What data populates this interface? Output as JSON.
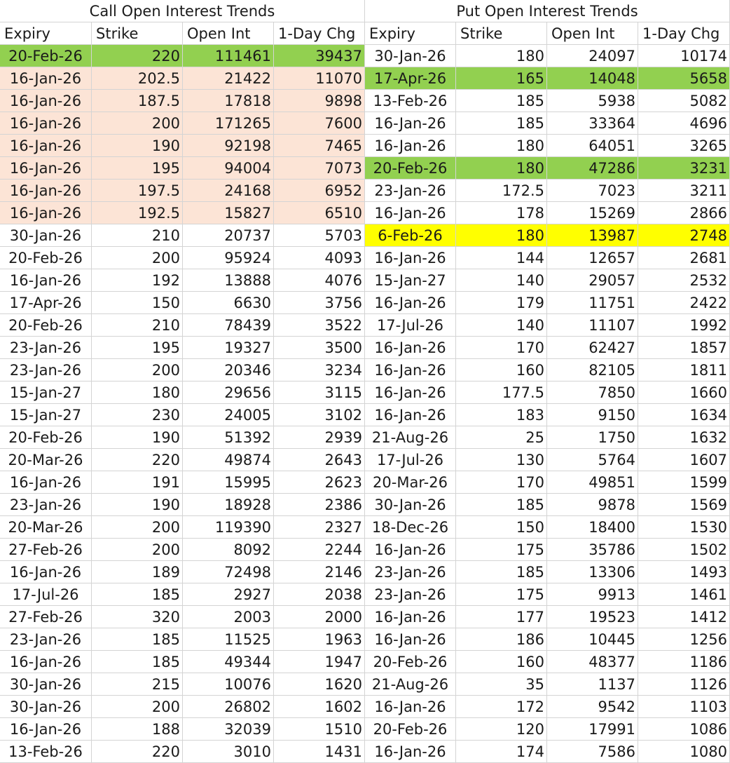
{
  "colors": {
    "pink": "#fce4d6",
    "green": "#92d050",
    "yellow": "#ffff00",
    "gridline": "#d4d4d4"
  },
  "call": {
    "title": "Call Open Interest Trends",
    "headers": [
      "Expiry",
      "Strike",
      "Open Int",
      "1-Day Chg"
    ],
    "rows": [
      [
        "20-Feb-26",
        "220",
        "111461",
        "39437",
        "green"
      ],
      [
        "16-Jan-26",
        "202.5",
        "21422",
        "11070",
        "pink"
      ],
      [
        "16-Jan-26",
        "187.5",
        "17818",
        "9898",
        "pink"
      ],
      [
        "16-Jan-26",
        "200",
        "171265",
        "7600",
        "pink"
      ],
      [
        "16-Jan-26",
        "190",
        "92198",
        "7465",
        "pink"
      ],
      [
        "16-Jan-26",
        "195",
        "94004",
        "7073",
        "pink"
      ],
      [
        "16-Jan-26",
        "197.5",
        "24168",
        "6952",
        "pink"
      ],
      [
        "16-Jan-26",
        "192.5",
        "15827",
        "6510",
        "pink"
      ],
      [
        "30-Jan-26",
        "210",
        "20737",
        "5703",
        ""
      ],
      [
        "20-Feb-26",
        "200",
        "95924",
        "4093",
        ""
      ],
      [
        "16-Jan-26",
        "192",
        "13888",
        "4076",
        ""
      ],
      [
        "17-Apr-26",
        "150",
        "6630",
        "3756",
        ""
      ],
      [
        "20-Feb-26",
        "210",
        "78439",
        "3522",
        ""
      ],
      [
        "23-Jan-26",
        "195",
        "19327",
        "3500",
        ""
      ],
      [
        "23-Jan-26",
        "200",
        "20346",
        "3234",
        ""
      ],
      [
        "15-Jan-27",
        "180",
        "29656",
        "3115",
        ""
      ],
      [
        "15-Jan-27",
        "230",
        "24005",
        "3102",
        ""
      ],
      [
        "20-Feb-26",
        "190",
        "51392",
        "2939",
        ""
      ],
      [
        "20-Mar-26",
        "220",
        "49874",
        "2643",
        ""
      ],
      [
        "16-Jan-26",
        "191",
        "15995",
        "2623",
        ""
      ],
      [
        "23-Jan-26",
        "190",
        "18928",
        "2386",
        ""
      ],
      [
        "20-Mar-26",
        "200",
        "119390",
        "2327",
        ""
      ],
      [
        "27-Feb-26",
        "200",
        "8092",
        "2244",
        ""
      ],
      [
        "16-Jan-26",
        "189",
        "72498",
        "2146",
        ""
      ],
      [
        "17-Jul-26",
        "185",
        "2927",
        "2038",
        ""
      ],
      [
        "27-Feb-26",
        "320",
        "2003",
        "2000",
        ""
      ],
      [
        "23-Jan-26",
        "185",
        "11525",
        "1963",
        ""
      ],
      [
        "16-Jan-26",
        "185",
        "49344",
        "1947",
        ""
      ],
      [
        "30-Jan-26",
        "215",
        "10076",
        "1620",
        ""
      ],
      [
        "30-Jan-26",
        "200",
        "26802",
        "1602",
        ""
      ],
      [
        "16-Jan-26",
        "188",
        "32039",
        "1510",
        ""
      ],
      [
        "13-Feb-26",
        "220",
        "3010",
        "1431",
        ""
      ]
    ]
  },
  "put": {
    "title": "Put Open Interest Trends",
    "headers": [
      "Expiry",
      "Strike",
      "Open Int",
      "1-Day Chg"
    ],
    "rows": [
      [
        "30-Jan-26",
        "180",
        "24097",
        "10174",
        ""
      ],
      [
        "17-Apr-26",
        "165",
        "14048",
        "5658",
        "green"
      ],
      [
        "13-Feb-26",
        "185",
        "5938",
        "5082",
        ""
      ],
      [
        "16-Jan-26",
        "185",
        "33364",
        "4696",
        ""
      ],
      [
        "16-Jan-26",
        "180",
        "64051",
        "3265",
        ""
      ],
      [
        "20-Feb-26",
        "180",
        "47286",
        "3231",
        "green"
      ],
      [
        "23-Jan-26",
        "172.5",
        "7023",
        "3211",
        ""
      ],
      [
        "16-Jan-26",
        "178",
        "15269",
        "2866",
        ""
      ],
      [
        "6-Feb-26",
        "180",
        "13987",
        "2748",
        "yellow"
      ],
      [
        "16-Jan-26",
        "144",
        "12657",
        "2681",
        ""
      ],
      [
        "15-Jan-27",
        "140",
        "29057",
        "2532",
        ""
      ],
      [
        "16-Jan-26",
        "179",
        "11751",
        "2422",
        ""
      ],
      [
        "17-Jul-26",
        "140",
        "11107",
        "1992",
        ""
      ],
      [
        "16-Jan-26",
        "170",
        "62427",
        "1857",
        ""
      ],
      [
        "16-Jan-26",
        "160",
        "82105",
        "1811",
        ""
      ],
      [
        "16-Jan-26",
        "177.5",
        "7850",
        "1660",
        ""
      ],
      [
        "16-Jan-26",
        "183",
        "9150",
        "1634",
        ""
      ],
      [
        "21-Aug-26",
        "25",
        "1750",
        "1632",
        ""
      ],
      [
        "17-Jul-26",
        "130",
        "5764",
        "1607",
        ""
      ],
      [
        "20-Mar-26",
        "170",
        "49851",
        "1599",
        ""
      ],
      [
        "30-Jan-26",
        "185",
        "9878",
        "1569",
        ""
      ],
      [
        "18-Dec-26",
        "150",
        "18400",
        "1530",
        ""
      ],
      [
        "16-Jan-26",
        "175",
        "35786",
        "1502",
        ""
      ],
      [
        "23-Jan-26",
        "185",
        "13306",
        "1493",
        ""
      ],
      [
        "23-Jan-26",
        "175",
        "9913",
        "1461",
        ""
      ],
      [
        "16-Jan-26",
        "177",
        "19523",
        "1412",
        ""
      ],
      [
        "16-Jan-26",
        "186",
        "10445",
        "1256",
        ""
      ],
      [
        "20-Feb-26",
        "160",
        "48377",
        "1186",
        ""
      ],
      [
        "21-Aug-26",
        "35",
        "1137",
        "1126",
        ""
      ],
      [
        "16-Jan-26",
        "172",
        "9542",
        "1103",
        ""
      ],
      [
        "20-Feb-26",
        "120",
        "17991",
        "1086",
        ""
      ],
      [
        "16-Jan-26",
        "174",
        "7586",
        "1080",
        ""
      ]
    ]
  }
}
